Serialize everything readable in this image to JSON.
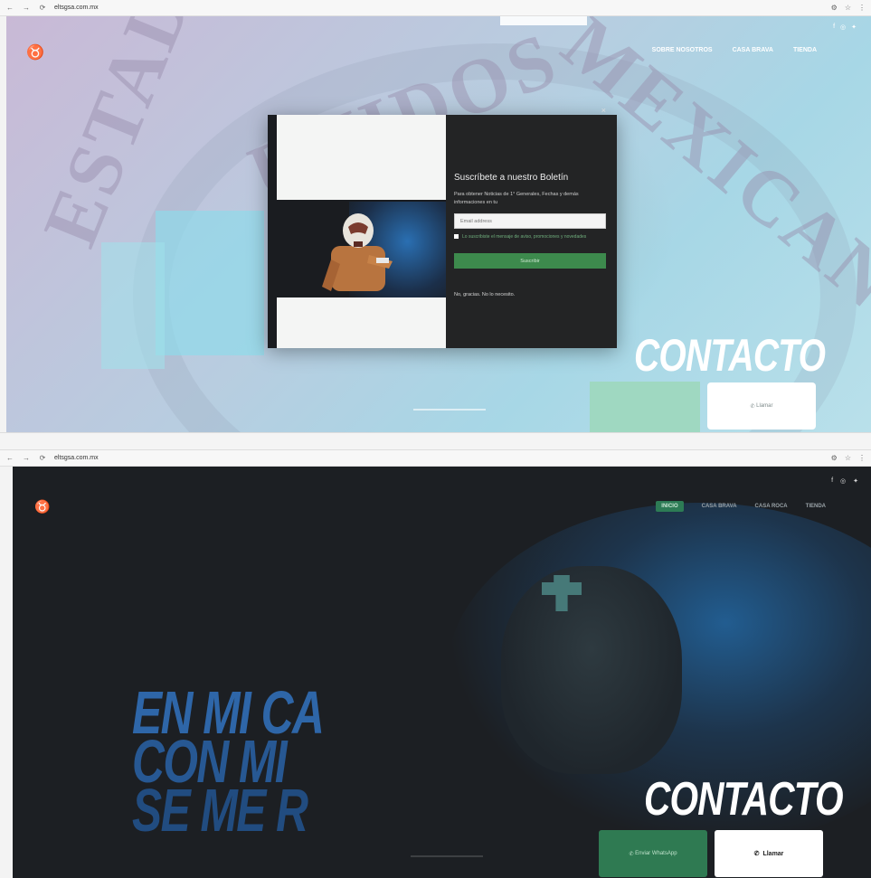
{
  "screenshot_top": {
    "browser": {
      "url": "eltsgsa.com.mx",
      "back_icon": "←",
      "forward_icon": "→",
      "reload_icon": "⟳"
    },
    "site": {
      "logo_icon": "wrestler-mask-logo",
      "nav": [
        "SOBRE NOSOTROS",
        "CASA BRAVA",
        "TIENDA"
      ],
      "background_watermark": [
        "ESTADOS",
        "UNIDOS",
        "MEXICANOS"
      ]
    },
    "popup": {
      "close_label": "×",
      "title": "Suscríbete a nuestro Boletín",
      "description": "Para obtener Noticias de 1° Generales, Fechas y demás informaciones en tu",
      "email_placeholder": "Email address",
      "consent_text": "Lo suscribiste el mensaje de aviso, promociones y novedades",
      "submit_label": "Suscribir",
      "dismiss_label": "No, gracias. No lo necesito."
    },
    "hero": {
      "contacto": "CONTACTO",
      "call_label": "Llamar"
    }
  },
  "screenshot_bottom": {
    "browser": {
      "url": "eltsgsa.com.mx"
    },
    "site": {
      "logo_icon": "wrestler-mask-logo",
      "nav_active": "INICIO",
      "nav": [
        "CASA BRAVA",
        "CASA ROCA",
        "TIENDA"
      ],
      "social_icons": [
        "facebook-icon",
        "instagram-icon",
        "twitter-icon"
      ]
    },
    "hero": {
      "headline_line1": "EN MI CA",
      "headline_line2": "CON MI",
      "headline_line3": "SE ME R",
      "contacto": "CONTACTO",
      "whatsapp_label": "Enviar WhatsApp",
      "call_label": "Llamar"
    }
  }
}
